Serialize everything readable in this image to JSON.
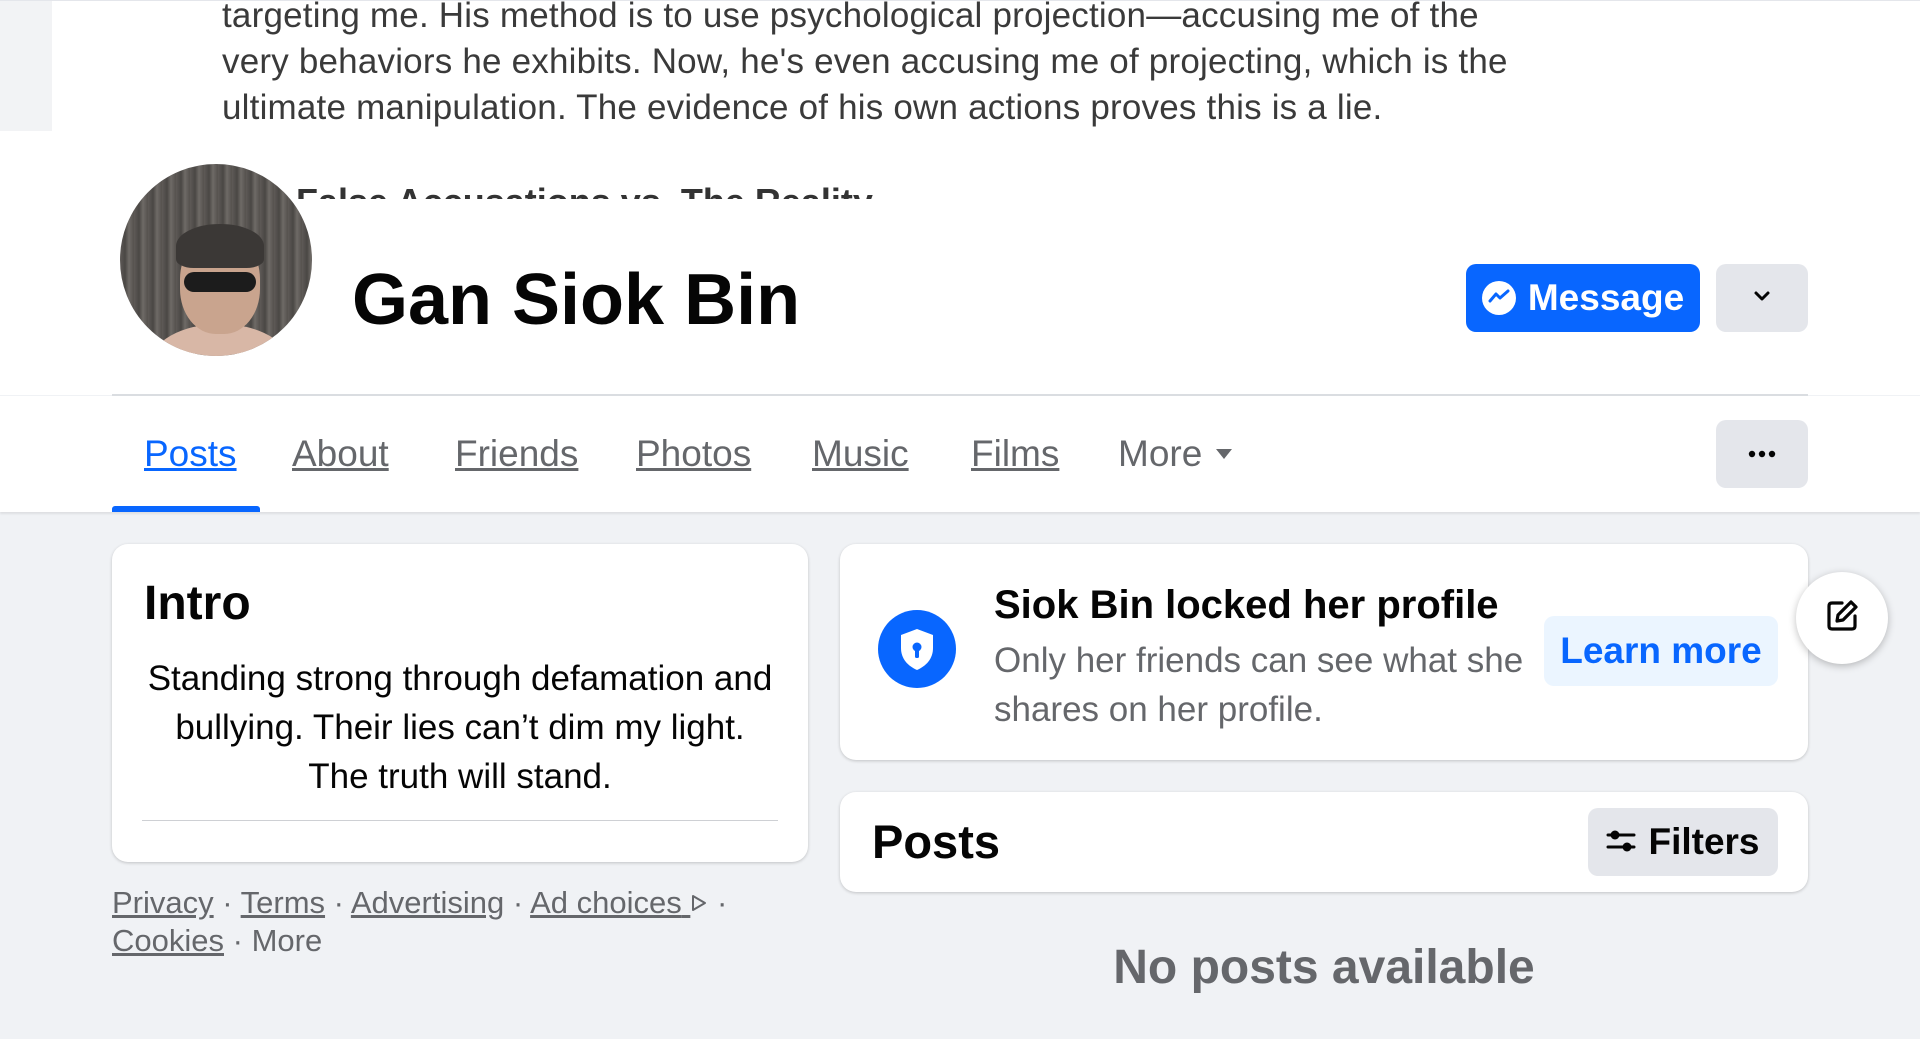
{
  "cover": {
    "lines": [
      "targeting me. His method is to use psychological projection—accusing me of the",
      "very behaviors he exhibits. Now, he's even accusing me of projecting, which is the",
      "ultimate manipulation. The evidence of his own actions proves this is a lie."
    ],
    "heading": "False Accusations vs. The Reality"
  },
  "profile": {
    "name": "Gan Siok Bin",
    "message_label": "Message"
  },
  "tabs": [
    {
      "label": "Posts",
      "active": true
    },
    {
      "label": "About"
    },
    {
      "label": "Friends"
    },
    {
      "label": "Photos"
    },
    {
      "label": "Music"
    },
    {
      "label": "Films"
    },
    {
      "label": "More"
    }
  ],
  "intro": {
    "title": "Intro",
    "bio": "Standing strong through defamation and bullying. Their lies can’t dim my light. The truth will stand."
  },
  "footer": {
    "links": [
      "Privacy",
      "Terms",
      "Advertising",
      "Ad choices",
      "Cookies",
      "More"
    ]
  },
  "lock_notice": {
    "title": "Siok Bin locked her profile",
    "description": "Only her friends can see what she shares on her profile.",
    "learn_more_label": "Learn more"
  },
  "posts": {
    "title": "Posts",
    "filters_label": "Filters",
    "empty_text": "No posts available"
  },
  "colors": {
    "accent": "#0866ff",
    "page_background": "#f0f2f5",
    "secondary_text": "#65676b",
    "button_gray": "#e4e6eb"
  },
  "icons": {
    "message_button": "messenger-icon",
    "dropdown": "chevron-down-icon",
    "tab_more": "caret-down-icon",
    "tab_overflow": "ellipsis-icon",
    "lock": "shield-lock-icon",
    "filters": "sliders-icon",
    "ad_choices": "ad-choices-icon",
    "edit": "edit-icon"
  }
}
